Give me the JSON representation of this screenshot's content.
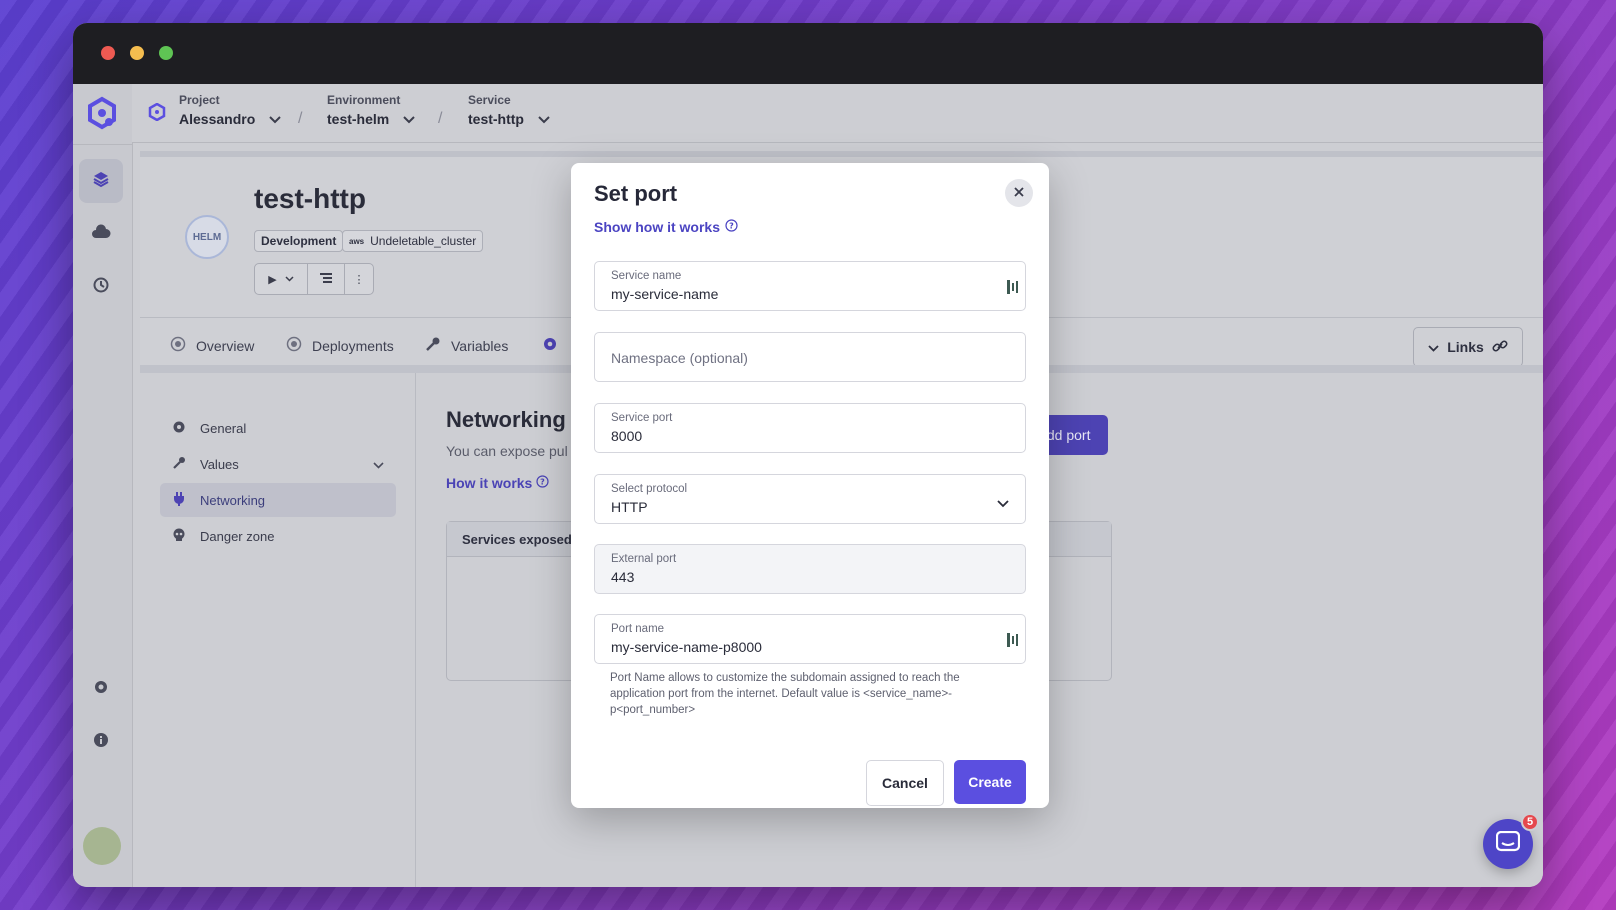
{
  "breadcrumb": {
    "project": {
      "label": "Project",
      "value": "Alessandro"
    },
    "environment": {
      "label": "Environment",
      "value": "test-helm"
    },
    "service": {
      "label": "Service",
      "value": "test-http"
    }
  },
  "service_header": {
    "title": "test-http",
    "helm_logo_text": "HELM",
    "badge_env": "Development",
    "badge_cluster": "Undeletable_cluster",
    "aws_label": "aws"
  },
  "tabs": [
    {
      "label": "Overview"
    },
    {
      "label": "Deployments"
    },
    {
      "label": "Variables"
    }
  ],
  "links_button": "Links",
  "settings_nav": [
    {
      "label": "General"
    },
    {
      "label": "Values"
    },
    {
      "label": "Networking"
    },
    {
      "label": "Danger zone"
    }
  ],
  "networking": {
    "title": "Networking",
    "description": "You can expose pul",
    "how_it_works": "How it works",
    "add_port": "Add port",
    "table_header": "Services exposed"
  },
  "modal": {
    "title": "Set port",
    "show_how": "Show how it works",
    "service_name": {
      "label": "Service name",
      "value": "my-service-name"
    },
    "namespace": {
      "placeholder": "Namespace (optional)"
    },
    "service_port": {
      "label": "Service port",
      "value": "8000"
    },
    "protocol": {
      "label": "Select protocol",
      "value": "HTTP"
    },
    "external_port": {
      "label": "External port",
      "value": "443"
    },
    "port_name": {
      "label": "Port name",
      "value": "my-service-name-p8000"
    },
    "helper_text": "Port Name allows to customize the subdomain assigned to reach the application port from the internet. Default value is <service_name>-p<port_number>",
    "cancel": "Cancel",
    "create": "Create"
  },
  "chat": {
    "unread": "5"
  },
  "colors": {
    "accent": "#5b4fe0",
    "link": "#4b44c2"
  }
}
